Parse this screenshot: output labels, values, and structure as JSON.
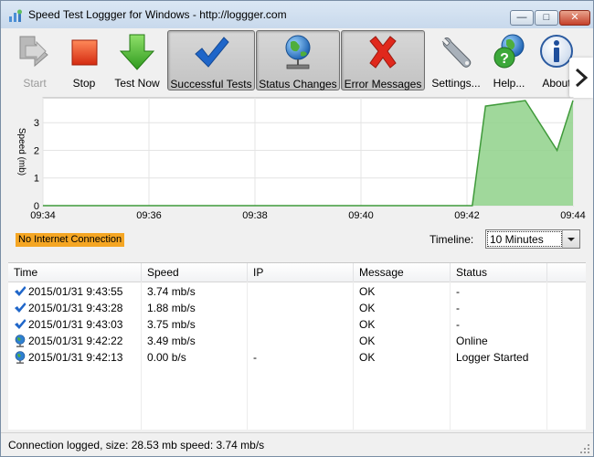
{
  "window": {
    "title": "Speed Test Loggger for Windows - http://loggger.com",
    "minimize_glyph": "—",
    "maximize_glyph": "□",
    "close_glyph": "✕"
  },
  "toolbar": {
    "buttons": [
      {
        "label": "Start",
        "icon": "start-arrows-icon",
        "state": "disabled"
      },
      {
        "label": "Stop",
        "icon": "stop-square-icon",
        "state": "normal"
      },
      {
        "label": "Test Now",
        "icon": "down-arrow-icon",
        "state": "normal"
      },
      {
        "label": "Successful Tests",
        "icon": "checkmark-icon",
        "state": "toggled"
      },
      {
        "label": "Status Changes",
        "icon": "globe-network-icon",
        "state": "toggled"
      },
      {
        "label": "Error Messages",
        "icon": "red-x-icon",
        "state": "toggled"
      },
      {
        "label": "Settings...",
        "icon": "wrench-icon",
        "state": "normal"
      },
      {
        "label": "Help...",
        "icon": "help-globe-icon",
        "state": "normal"
      },
      {
        "label": "About",
        "icon": "info-icon",
        "state": "normal"
      }
    ],
    "overflow_glyph": ">"
  },
  "chart_data": {
    "type": "area",
    "ylabel": "Speed (mb)",
    "x_ticks": [
      "09:34",
      "09:36",
      "09:38",
      "09:40",
      "09:42",
      "09:44"
    ],
    "y_ticks": [
      "0",
      "1",
      "2",
      "3"
    ],
    "ylim": [
      0,
      3.9
    ],
    "xlim": [
      0,
      10
    ],
    "x": [
      0,
      8.1,
      8.35,
      9.1,
      9.7,
      10
    ],
    "values": [
      0,
      0,
      3.6,
      3.8,
      2.0,
      3.8
    ],
    "fill_color": "#8fd18a",
    "line_color": "#3f9a3a",
    "grid": true
  },
  "status_strip": {
    "connection_text": "No Internet Connection",
    "connection_color": "#f5a623",
    "timeline_label": "Timeline:",
    "timeline_value": "10 Minutes"
  },
  "log": {
    "columns": [
      "Time",
      "Speed",
      "IP",
      "Message",
      "Status"
    ],
    "rows": [
      {
        "icon": "check-icon",
        "time": "2015/01/31 9:43:55",
        "speed": "3.74 mb/s",
        "ip": "",
        "message": "OK",
        "status": "-"
      },
      {
        "icon": "check-icon",
        "time": "2015/01/31 9:43:28",
        "speed": "1.88 mb/s",
        "ip": "",
        "message": "OK",
        "status": "-"
      },
      {
        "icon": "check-icon",
        "time": "2015/01/31 9:43:03",
        "speed": "3.75 mb/s",
        "ip": "",
        "message": "OK",
        "status": "-"
      },
      {
        "icon": "globe-icon",
        "time": "2015/01/31 9:42:22",
        "speed": "3.49 mb/s",
        "ip": "",
        "message": "OK",
        "status": "Online"
      },
      {
        "icon": "globe-icon",
        "time": "2015/01/31 9:42:13",
        "speed": "0.00 b/s",
        "ip": "-",
        "message": "OK",
        "status": "Logger Started"
      }
    ]
  },
  "statusbar": {
    "text": "Connection logged, size: 28.53 mb speed: 3.74 mb/s"
  }
}
